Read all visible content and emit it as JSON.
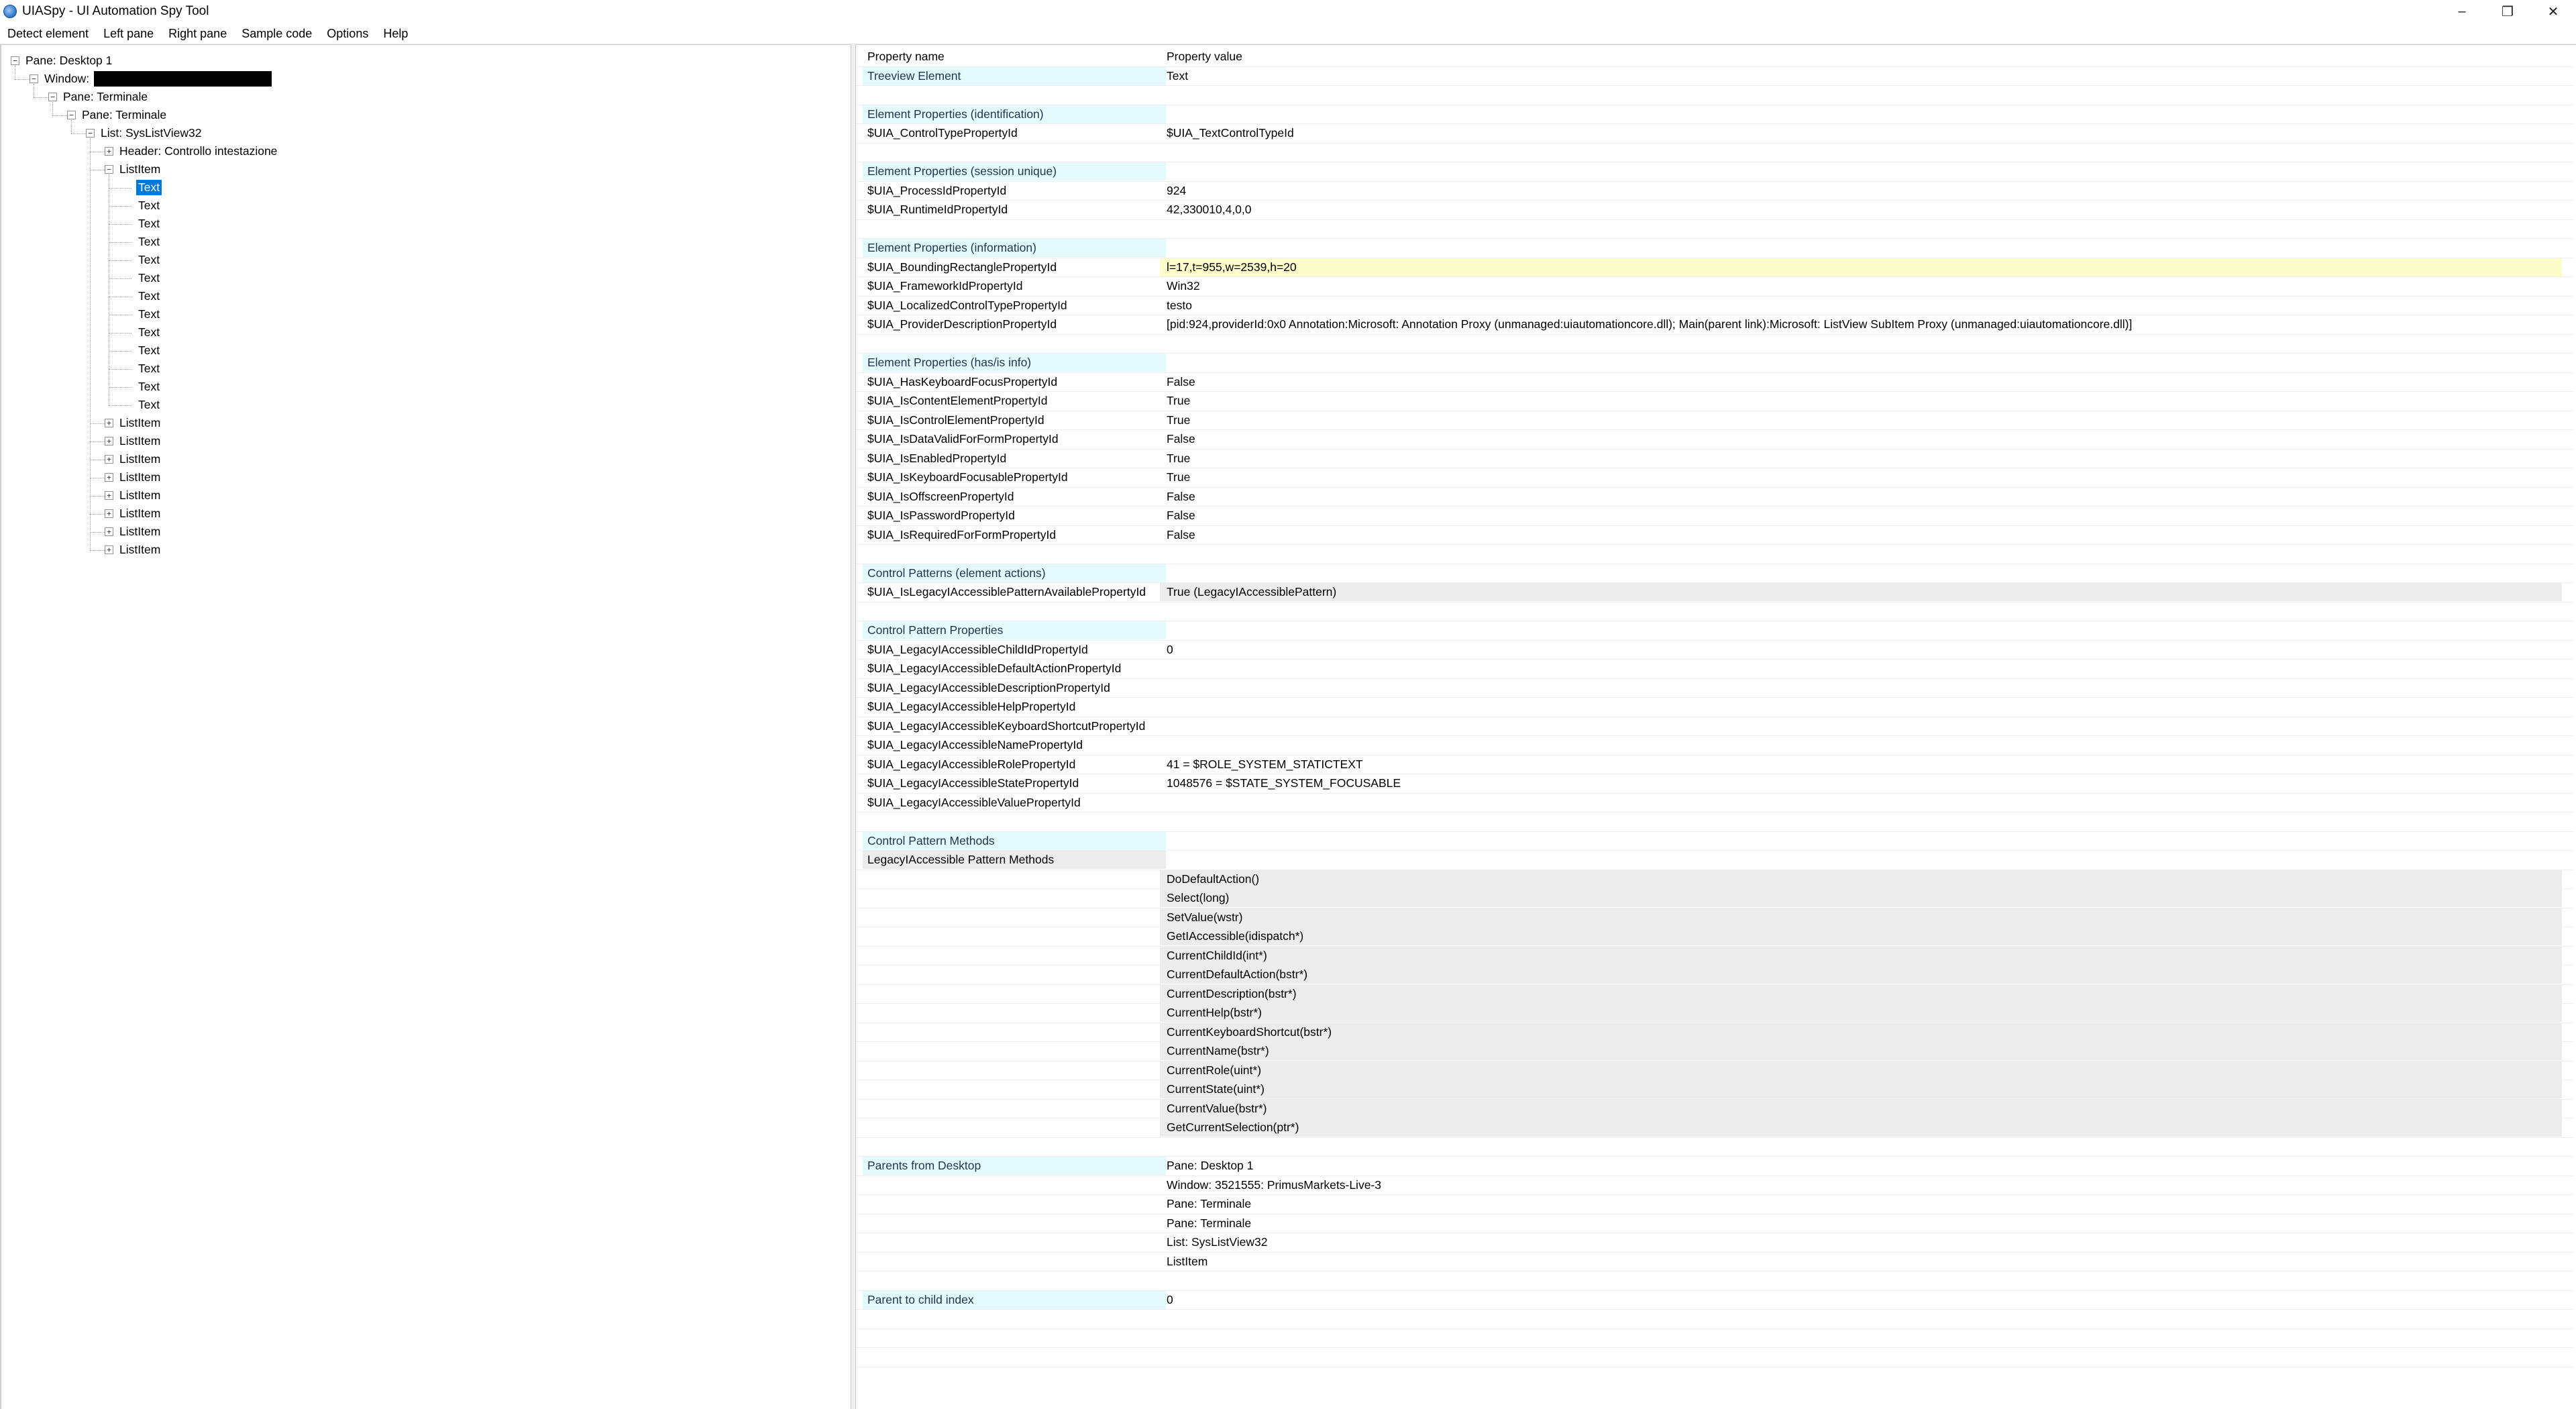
{
  "window": {
    "title": "UIASpy - UI Automation Spy Tool",
    "controls": [
      "–",
      "❐",
      "✕"
    ]
  },
  "menu": [
    "Detect element",
    "Left pane",
    "Right pane",
    "Sample code",
    "Options",
    "Help"
  ],
  "tree": [
    {
      "label": "Pane: Desktop 1",
      "level": 0,
      "expander": "minus"
    },
    {
      "label": "Window:",
      "level": 1,
      "expander": "minus",
      "redacted": true
    },
    {
      "label": "Pane: Terminale",
      "level": 2,
      "expander": "minus"
    },
    {
      "label": "Pane: Terminale",
      "level": 3,
      "expander": "minus"
    },
    {
      "label": "List: SysListView32",
      "level": 4,
      "expander": "minus"
    },
    {
      "label": "Header: Controllo intestazione",
      "level": 5,
      "expander": "plus"
    },
    {
      "label": "ListItem",
      "level": 5,
      "expander": "minus"
    },
    {
      "label": "Text",
      "level": 6,
      "selected": true
    },
    {
      "label": "Text",
      "level": 6
    },
    {
      "label": "Text",
      "level": 6
    },
    {
      "label": "Text",
      "level": 6
    },
    {
      "label": "Text",
      "level": 6
    },
    {
      "label": "Text",
      "level": 6
    },
    {
      "label": "Text",
      "level": 6
    },
    {
      "label": "Text",
      "level": 6
    },
    {
      "label": "Text",
      "level": 6
    },
    {
      "label": "Text",
      "level": 6
    },
    {
      "label": "Text",
      "level": 6
    },
    {
      "label": "Text",
      "level": 6
    },
    {
      "label": "Text",
      "level": 6
    },
    {
      "label": "ListItem",
      "level": 5,
      "expander": "plus"
    },
    {
      "label": "ListItem",
      "level": 5,
      "expander": "plus"
    },
    {
      "label": "ListItem",
      "level": 5,
      "expander": "plus"
    },
    {
      "label": "ListItem",
      "level": 5,
      "expander": "plus"
    },
    {
      "label": "ListItem",
      "level": 5,
      "expander": "plus"
    },
    {
      "label": "ListItem",
      "level": 5,
      "expander": "plus"
    },
    {
      "label": "ListItem",
      "level": 5,
      "expander": "plus"
    },
    {
      "label": "ListItem",
      "level": 5,
      "expander": "plus"
    }
  ],
  "properties": [
    {
      "name": "Property name",
      "value": "Property value",
      "style": "hdr"
    },
    {
      "name": "Treeview Element",
      "value": "Text",
      "style": "sec"
    },
    {
      "name": "",
      "value": "",
      "style": ""
    },
    {
      "name": "Element Properties (identification)",
      "value": "",
      "style": "sec"
    },
    {
      "name": "$UIA_ControlTypePropertyId",
      "value": "$UIA_TextControlTypeId",
      "style": ""
    },
    {
      "name": "",
      "value": "",
      "style": ""
    },
    {
      "name": "Element Properties (session unique)",
      "value": "",
      "style": "sec"
    },
    {
      "name": "$UIA_ProcessIdPropertyId",
      "value": "924",
      "style": ""
    },
    {
      "name": "$UIA_RuntimeIdPropertyId",
      "value": "42,330010,4,0,0",
      "style": ""
    },
    {
      "name": "",
      "value": "",
      "style": ""
    },
    {
      "name": "Element Properties (information)",
      "value": "",
      "style": "sec"
    },
    {
      "name": "$UIA_BoundingRectanglePropertyId",
      "value": "l=17,t=955,w=2539,h=20",
      "style": "vyellow"
    },
    {
      "name": "$UIA_FrameworkIdPropertyId",
      "value": "Win32",
      "style": ""
    },
    {
      "name": "$UIA_LocalizedControlTypePropertyId",
      "value": "testo",
      "style": ""
    },
    {
      "name": "$UIA_ProviderDescriptionPropertyId",
      "value": "[pid:924,providerId:0x0 Annotation:Microsoft: Annotation Proxy (unmanaged:uiautomationcore.dll); Main(parent link):Microsoft: ListView SubItem Proxy (unmanaged:uiautomationcore.dll)]",
      "style": ""
    },
    {
      "name": "",
      "value": "",
      "style": ""
    },
    {
      "name": "Element Properties (has/is info)",
      "value": "",
      "style": "sec"
    },
    {
      "name": "$UIA_HasKeyboardFocusPropertyId",
      "value": "False",
      "style": ""
    },
    {
      "name": "$UIA_IsContentElementPropertyId",
      "value": "True",
      "style": ""
    },
    {
      "name": "$UIA_IsControlElementPropertyId",
      "value": "True",
      "style": ""
    },
    {
      "name": "$UIA_IsDataValidForFormPropertyId",
      "value": "False",
      "style": ""
    },
    {
      "name": "$UIA_IsEnabledPropertyId",
      "value": "True",
      "style": ""
    },
    {
      "name": "$UIA_IsKeyboardFocusablePropertyId",
      "value": "True",
      "style": ""
    },
    {
      "name": "$UIA_IsOffscreenPropertyId",
      "value": "False",
      "style": ""
    },
    {
      "name": "$UIA_IsPasswordPropertyId",
      "value": "False",
      "style": ""
    },
    {
      "name": "$UIA_IsRequiredForFormPropertyId",
      "value": "False",
      "style": ""
    },
    {
      "name": "",
      "value": "",
      "style": ""
    },
    {
      "name": "Control Patterns (element actions)",
      "value": "",
      "style": "sec"
    },
    {
      "name": "$UIA_IsLegacyIAccessiblePatternAvailablePropertyId",
      "value": "True (LegacyIAccessiblePattern)",
      "style": "vgrey"
    },
    {
      "name": "",
      "value": "",
      "style": ""
    },
    {
      "name": "Control Pattern Properties",
      "value": "",
      "style": "sec"
    },
    {
      "name": "$UIA_LegacyIAccessibleChildIdPropertyId",
      "value": "0",
      "style": ""
    },
    {
      "name": "$UIA_LegacyIAccessibleDefaultActionPropertyId",
      "value": "",
      "style": ""
    },
    {
      "name": "$UIA_LegacyIAccessibleDescriptionPropertyId",
      "value": "",
      "style": ""
    },
    {
      "name": "$UIA_LegacyIAccessibleHelpPropertyId",
      "value": "",
      "style": ""
    },
    {
      "name": "$UIA_LegacyIAccessibleKeyboardShortcutPropertyId",
      "value": "",
      "style": ""
    },
    {
      "name": "$UIA_LegacyIAccessibleNamePropertyId",
      "value": "",
      "style": ""
    },
    {
      "name": "$UIA_LegacyIAccessibleRolePropertyId",
      "value": "41 = $ROLE_SYSTEM_STATICTEXT",
      "style": ""
    },
    {
      "name": "$UIA_LegacyIAccessibleStatePropertyId",
      "value": "1048576 = $STATE_SYSTEM_FOCUSABLE",
      "style": ""
    },
    {
      "name": "$UIA_LegacyIAccessibleValuePropertyId",
      "value": "",
      "style": ""
    },
    {
      "name": "",
      "value": "",
      "style": ""
    },
    {
      "name": "Control Pattern Methods",
      "value": "",
      "style": "sec"
    },
    {
      "name": "LegacyIAccessible Pattern Methods",
      "value": "",
      "style": "grey"
    },
    {
      "name": "",
      "value": "DoDefaultAction()",
      "style": "vgrey"
    },
    {
      "name": "",
      "value": "Select(long)",
      "style": "vgrey"
    },
    {
      "name": "",
      "value": "SetValue(wstr)",
      "style": "vgrey"
    },
    {
      "name": "",
      "value": "GetIAccessible(idispatch*)",
      "style": "vgrey"
    },
    {
      "name": "",
      "value": "CurrentChildId(int*)",
      "style": "vgrey"
    },
    {
      "name": "",
      "value": "CurrentDefaultAction(bstr*)",
      "style": "vgrey"
    },
    {
      "name": "",
      "value": "CurrentDescription(bstr*)",
      "style": "vgrey"
    },
    {
      "name": "",
      "value": "CurrentHelp(bstr*)",
      "style": "vgrey"
    },
    {
      "name": "",
      "value": "CurrentKeyboardShortcut(bstr*)",
      "style": "vgrey"
    },
    {
      "name": "",
      "value": "CurrentName(bstr*)",
      "style": "vgrey"
    },
    {
      "name": "",
      "value": "CurrentRole(uint*)",
      "style": "vgrey"
    },
    {
      "name": "",
      "value": "CurrentState(uint*)",
      "style": "vgrey"
    },
    {
      "name": "",
      "value": "CurrentValue(bstr*)",
      "style": "vgrey"
    },
    {
      "name": "",
      "value": "GetCurrentSelection(ptr*)",
      "style": "vgrey"
    },
    {
      "name": "",
      "value": "",
      "style": ""
    },
    {
      "name": "Parents from Desktop",
      "value": "Pane: Desktop 1",
      "style": "sec"
    },
    {
      "name": "",
      "value": "Window: 3521555: PrimusMarkets-Live-3",
      "style": ""
    },
    {
      "name": "",
      "value": "Pane: Terminale",
      "style": ""
    },
    {
      "name": "",
      "value": "Pane: Terminale",
      "style": ""
    },
    {
      "name": "",
      "value": "List: SysListView32",
      "style": ""
    },
    {
      "name": "",
      "value": "ListItem",
      "style": ""
    },
    {
      "name": "",
      "value": "",
      "style": ""
    },
    {
      "name": "Parent to child index",
      "value": "0",
      "style": "sec"
    },
    {
      "name": "",
      "value": "",
      "style": ""
    },
    {
      "name": "",
      "value": "",
      "style": ""
    },
    {
      "name": "",
      "value": "",
      "style": ""
    }
  ]
}
